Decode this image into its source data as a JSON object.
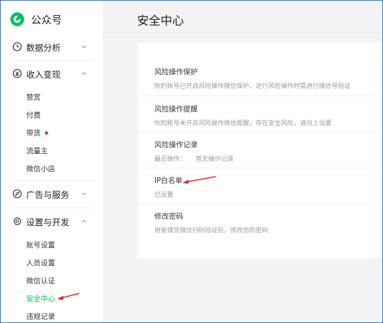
{
  "app": {
    "name": "公众号"
  },
  "page": {
    "title": "安全中心"
  },
  "sidebar": {
    "groups": [
      {
        "label": "数据分析",
        "expanded": false,
        "items": []
      },
      {
        "label": "收入变现",
        "expanded": true,
        "items": [
          "赞赏",
          "付费",
          "带货",
          "流量主",
          "微信小店"
        ]
      },
      {
        "label": "广告与服务",
        "expanded": false,
        "items": []
      },
      {
        "label": "设置与开发",
        "expanded": true,
        "items": [
          "账号设置",
          "人员设置",
          "微信认证",
          "安全中心",
          "违规记录"
        ]
      }
    ],
    "active_item": "安全中心",
    "badge_item": "带货"
  },
  "settings": [
    {
      "title": "风险操作保护",
      "desc": "你的账号已开启风险操作微信保护，进行风险操作时需进行微信号验证"
    },
    {
      "title": "风险操作提醒",
      "desc": "你的账号未开启风险操作微信提醒，存在安全风险，请马上设置"
    },
    {
      "title": "风险操作记录",
      "desc_label": "最近操作：",
      "desc_value": "暂无操作记录"
    },
    {
      "title": "IP白名单",
      "desc": "已设置"
    },
    {
      "title": "修改密码",
      "desc": "用管理员微信扫码验证后，修改你的密码"
    }
  ],
  "colors": {
    "accent": "#07c160",
    "badge": "#e53935",
    "annotation_arrow": "#e0242a"
  }
}
